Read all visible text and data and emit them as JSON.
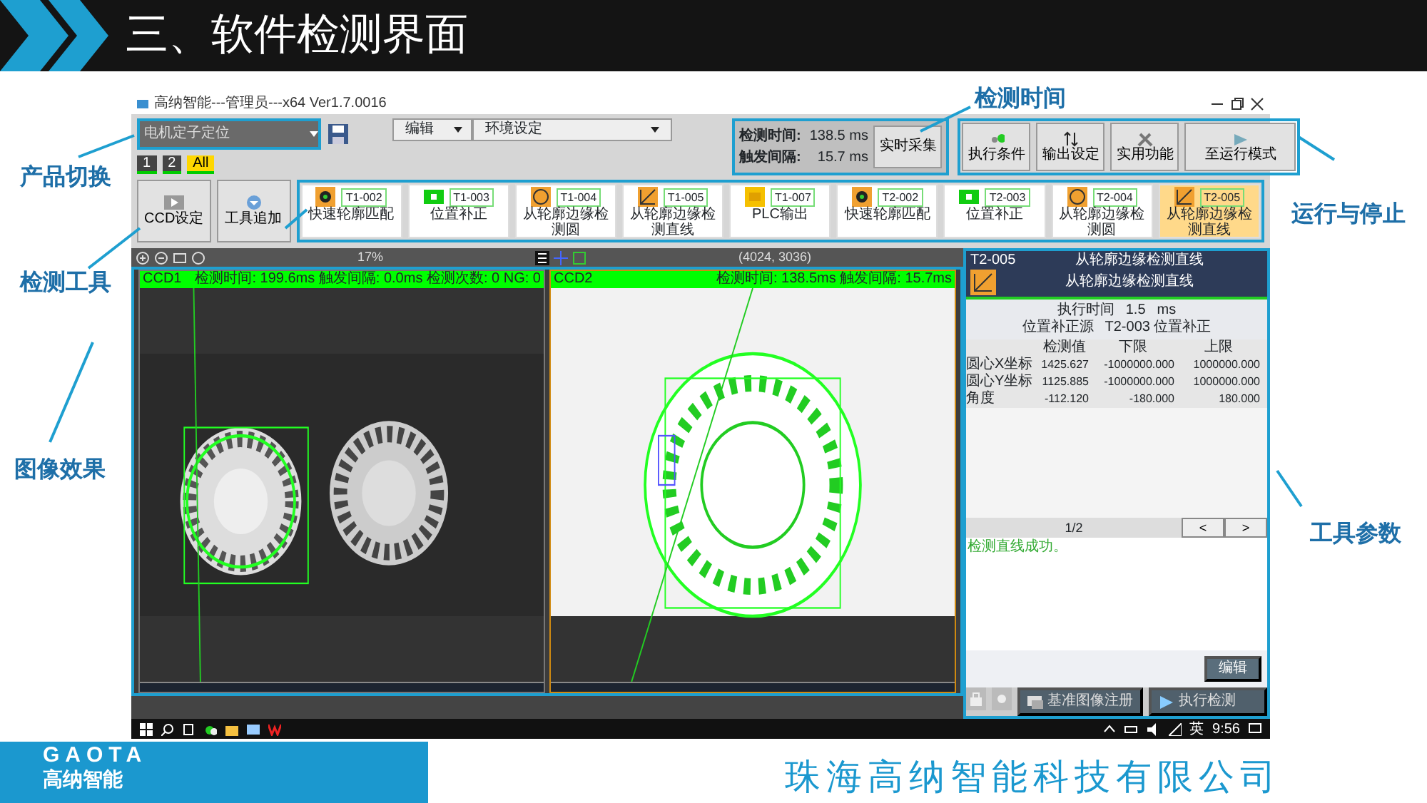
{
  "slide": {
    "title": "三、软件检测界面",
    "annotations": [
      {
        "label": "产品切换"
      },
      {
        "label": "检测工具"
      },
      {
        "label": "图像效果"
      },
      {
        "label": "检测时间"
      },
      {
        "label": "运行与停止"
      },
      {
        "label": "工具参数"
      }
    ],
    "logo": {
      "brand": "GAOTA",
      "name": "高纳智能"
    },
    "company": "珠海高纳智能科技有限公司"
  },
  "app": {
    "title": "高纳智能---管理员---x64 Ver1.7.0016",
    "product": "电机定子定位",
    "camera_tabs": [
      {
        "label": "1",
        "selected": false
      },
      {
        "label": "2",
        "selected": false
      },
      {
        "label": "All",
        "selected": true
      }
    ],
    "menus": [
      "编辑",
      "环境设定"
    ],
    "timing": {
      "rows": [
        {
          "label": "检测时间:",
          "value": "138.5 ms"
        },
        {
          "label": "触发间隔:",
          "value": "15.7 ms"
        }
      ],
      "button": "实时采集"
    },
    "actions": [
      "执行条件",
      "输出设定",
      "实用功能",
      "至运行模式"
    ],
    "left_buttons": [
      "CCD设定",
      "工具追加"
    ],
    "tools": [
      {
        "code": "T1-002",
        "name": "快速轮廓匹配",
        "kind": "match",
        "selected": false
      },
      {
        "code": "T1-003",
        "name": "位置补正",
        "kind": "position",
        "selected": false
      },
      {
        "code": "T1-004",
        "name": "从轮廓边缘检测圆",
        "kind": "circle",
        "selected": false
      },
      {
        "code": "T1-005",
        "name": "从轮廓边缘检测直线",
        "kind": "line",
        "selected": false
      },
      {
        "code": "T1-007",
        "name": "PLC输出",
        "kind": "plc",
        "selected": false
      },
      {
        "code": "T2-002",
        "name": "快速轮廓匹配",
        "kind": "match",
        "selected": false
      },
      {
        "code": "T2-003",
        "name": "位置补正",
        "kind": "position",
        "selected": false
      },
      {
        "code": "T2-004",
        "name": "从轮廓边缘检测圆",
        "kind": "circle",
        "selected": false
      },
      {
        "code": "T2-005",
        "name": "从轮廓边缘检测直线",
        "kind": "line",
        "selected": true
      }
    ],
    "viewer": {
      "zoom": "17%",
      "coords": "(4024, 3036)",
      "cameras": [
        {
          "name": "CCD1",
          "stats": "检测时间: 199.6ms 触发间隔: 0.0ms 检测次数: 0 NG: 0",
          "selected": false
        },
        {
          "name": "CCD2",
          "stats": "检测时间: 138.5ms 触发间隔: 15.7ms",
          "selected": true
        }
      ]
    },
    "panel": {
      "code": "T2-005",
      "title": "从轮廓边缘检测直线",
      "subtitle": "从轮廓边缘检测直线",
      "info": [
        {
          "label": "执行时间",
          "value": "1.5",
          "unit": "ms"
        },
        {
          "label": "位置补正源",
          "value": "T2-003 位置补正"
        }
      ],
      "columns": [
        "检测值",
        "下限",
        "上限"
      ],
      "rows": [
        {
          "name": "圆心X坐标",
          "values": [
            "1425.627",
            "-1000000.000",
            "1000000.000"
          ]
        },
        {
          "name": "圆心Y坐标",
          "values": [
            "1125.885",
            "-1000000.000",
            "1000000.000"
          ]
        },
        {
          "name": "角度",
          "values": [
            "-112.120",
            "-180.000",
            "180.000"
          ]
        }
      ],
      "page": "1/2",
      "prev": "<",
      "next": ">",
      "message": "检测直线成功。",
      "edit": "编辑",
      "bottom_buttons": [
        "基准图像注册",
        "执行检测"
      ]
    },
    "taskbar": {
      "ime": "英",
      "time": "9:56"
    }
  }
}
